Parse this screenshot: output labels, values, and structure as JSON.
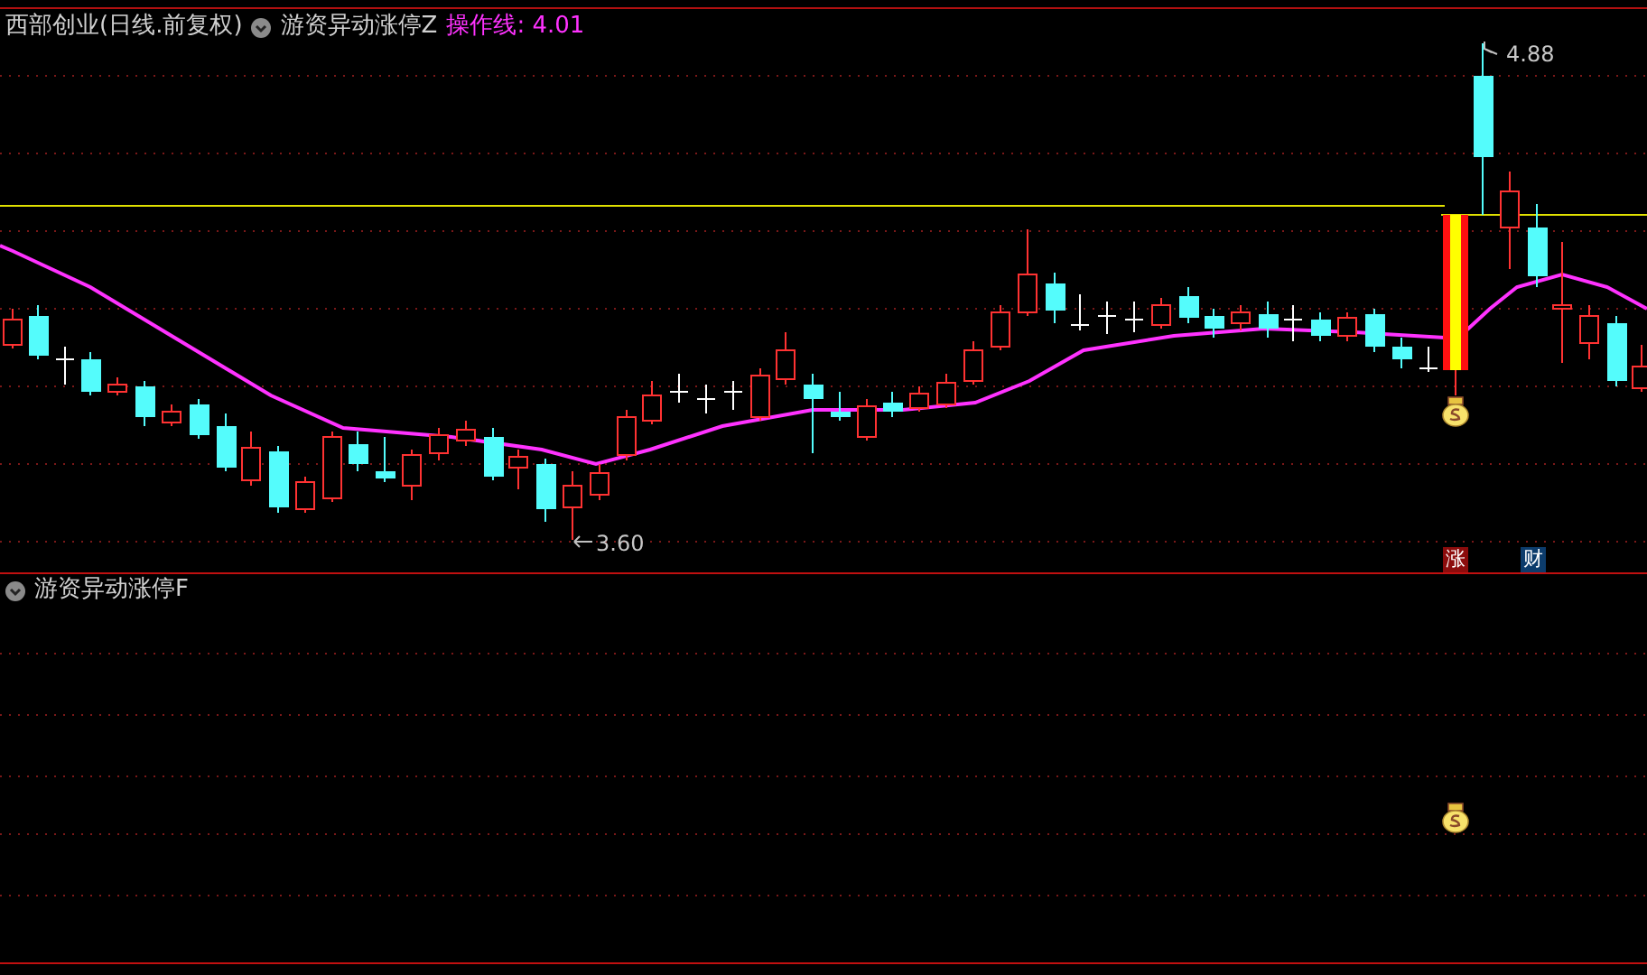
{
  "main_panel": {
    "security": "西部创业(日线.前复权)",
    "indicator": "游资异动涨停Z",
    "indicator_value": "操作线: 4.01",
    "high_label": "4.88",
    "low_label": "3.60",
    "badges": [
      {
        "kind": "rise",
        "text": "涨"
      },
      {
        "kind": "wealth",
        "text": "财"
      }
    ]
  },
  "sub_panel": {
    "indicator": "游资异动涨停F"
  }
}
